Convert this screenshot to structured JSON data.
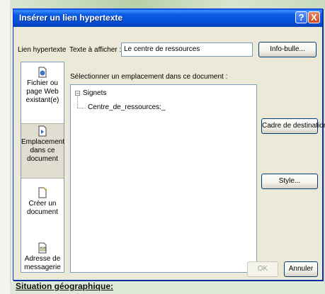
{
  "background": {
    "bottom_text": "Situation géographique:"
  },
  "dialog": {
    "title": "Insérer un lien hypertexte",
    "help_glyph": "?",
    "close_glyph": "X",
    "link_to_label": "Lien hypertexte",
    "text_to_display_label": "Texte à afficher :",
    "text_to_display_value": "Le centre de ressources",
    "screentip_button": "Info-bulle...",
    "select_place_label": "Sélectionner un emplacement dans ce document :",
    "tree": {
      "root": "Signets",
      "expander": "−",
      "child": "Centre_de_ressources:_"
    },
    "target_frame_button": "Cadre de destination...",
    "style_button": "Style...",
    "ok_button": "OK",
    "cancel_button": "Annuler",
    "link_targets": [
      {
        "label": "Fichier ou page Web existant(e)",
        "icon": "existing-file-icon"
      },
      {
        "label": "Emplacement dans ce document",
        "icon": "place-in-document-icon",
        "selected": true
      },
      {
        "label": "Créer un document",
        "icon": "create-document-icon"
      },
      {
        "label": "Adresse de messagerie",
        "icon": "email-address-icon"
      }
    ]
  },
  "colors": {
    "titlebar": "#0550d8",
    "dialog_face": "#ece9d8",
    "close_button": "#d2461c"
  }
}
